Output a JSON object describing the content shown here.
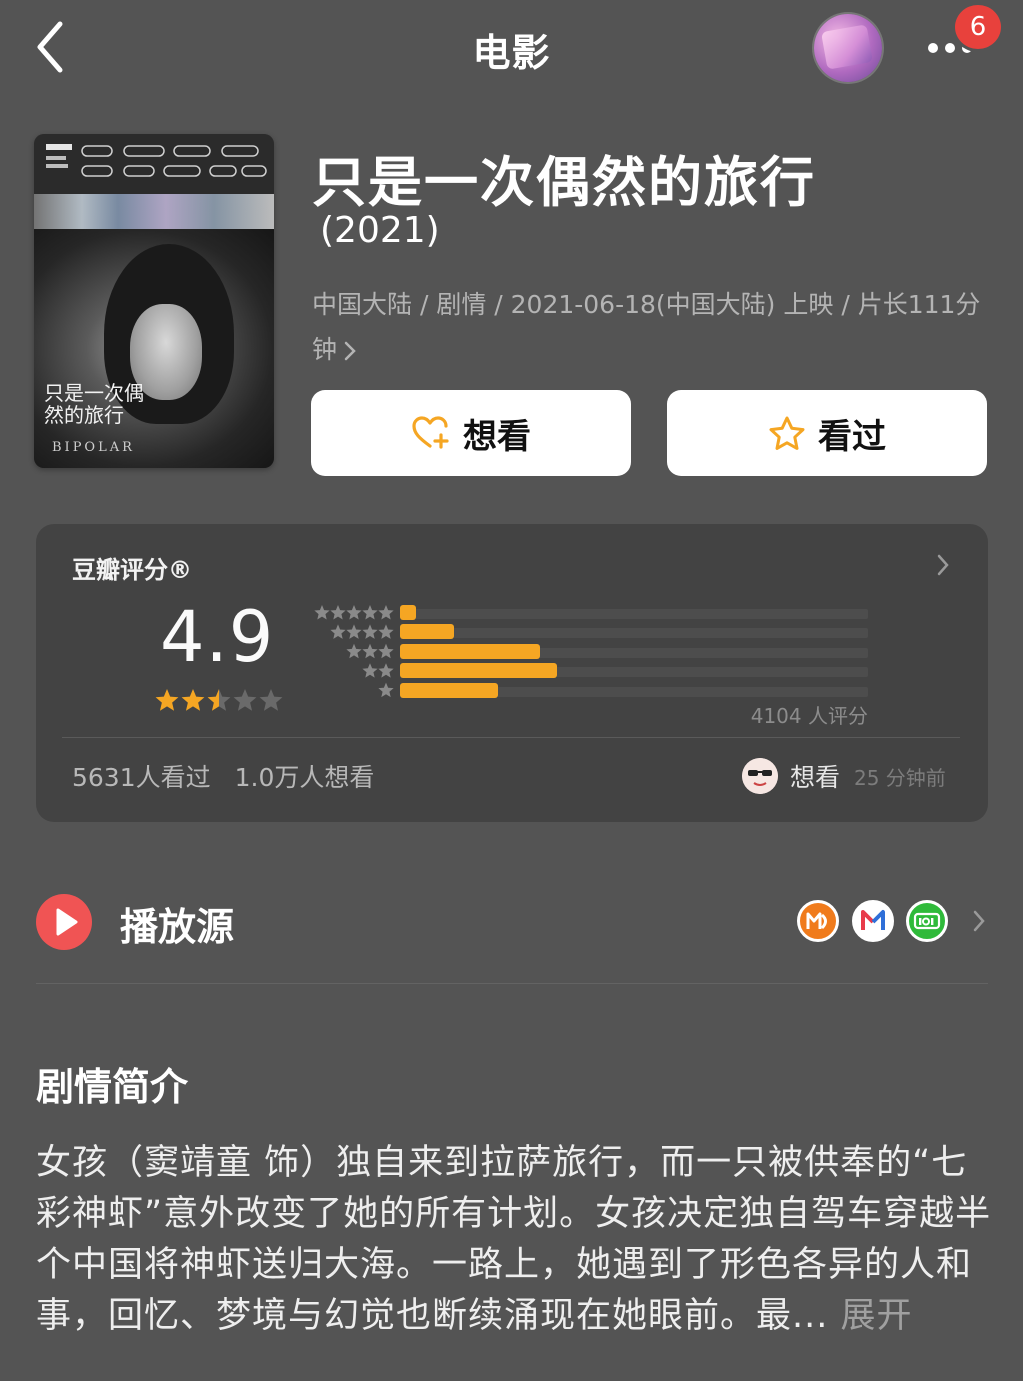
{
  "header": {
    "title": "电影",
    "notification_count": "6"
  },
  "poster": {
    "title_text": "只是一次偶然的旅行",
    "subtitle_text": "BIPOLAR"
  },
  "movie": {
    "title": "只是一次偶然的旅行",
    "year": "(2021)",
    "meta_line": "中国大陆 / 剧情 / 2021-06-18(中国大陆) 上映 / 片长111分钟"
  },
  "actions": {
    "want_label": "想看",
    "seen_label": "看过"
  },
  "rating": {
    "label": "豆瓣评分®",
    "score": "4.9",
    "score_stars": 2.5,
    "distribution_percent": [
      3.5,
      11.5,
      30,
      33.5,
      21
    ],
    "count_text": "4104 人评分",
    "seen_text": "5631人看过",
    "want_text": "1.0万人想看",
    "activity_status": "想看",
    "activity_time": "25 分钟前"
  },
  "sources": {
    "label": "播放源",
    "platforms": [
      "mango-tv-icon",
      "migu-video-icon",
      "iqiyi-icon"
    ]
  },
  "synopsis": {
    "title": "剧情简介",
    "text": "女孩（窦靖童 饰）独自来到拉萨旅行，而一只被供奉的“七彩神虾”意外改变了她的所有计划。女孩决定独自驾车穿越半个中国将神虾送归大海。一路上，她遇到了形色各异的人和事，回忆、梦境与幻觉也断续涌现在她眼前。最...",
    "expand_label": "展开"
  },
  "colors": {
    "background": "#545454",
    "card": "#434343",
    "accent_orange": "#f5a623",
    "play_red": "#f05454",
    "badge_red": "#e8413c"
  }
}
